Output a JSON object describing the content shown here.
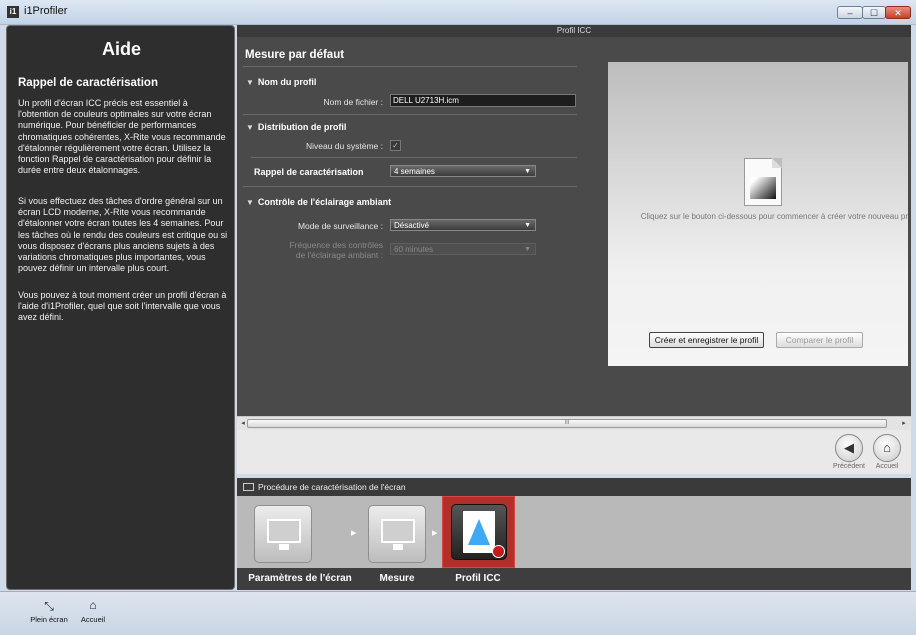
{
  "window": {
    "title": "i1Profiler",
    "app_icon": "i1",
    "controls": {
      "minimize": "‒",
      "maximize": "☐",
      "close": "✕"
    }
  },
  "help": {
    "title": "Aide",
    "subtitle": "Rappel de caractérisation",
    "paragraphs": [
      "Un profil d'écran ICC précis est essentiel à l'obtention de couleurs optimales sur votre écran numérique. Pour bénéficier de performances chromatiques cohérentes, X-Rite vous recommande d'étalonner régulièrement votre écran. Utilisez la fonction Rappel de caractérisation pour définir la durée entre deux étalonnages.",
      "Si vous effectuez des tâches d'ordre général sur un écran LCD moderne, X-Rite vous recommande d'étalonner votre écran toutes les 4 semaines. Pour les tâches où le rendu des couleurs est critique ou si vous disposez d'écrans plus anciens sujets à des variations chromatiques plus importantes, vous pouvez définir un intervalle plus court.",
      "Vous pouvez à tout moment créer un profil d'écran à l'aide d'i1Profiler, quel que soit l'intervalle que vous avez défini."
    ]
  },
  "main": {
    "header": "Profil ICC",
    "section_title": "Mesure par défaut",
    "profile_name": {
      "title": "Nom du profil",
      "filename_label": "Nom de fichier :",
      "filename_value": "DELL U2713H.icm"
    },
    "distribution": {
      "title": "Distribution de profil",
      "system_level_label": "Niveau du système :",
      "system_level_check": "✓"
    },
    "reminder": {
      "label": "Rappel de caractérisation",
      "value": "4 semaines"
    },
    "ambient": {
      "title": "Contrôle de l'éclairage ambiant",
      "mode_label": "Mode de surveillance :",
      "mode_value": "Désactivé",
      "frequency_label": "Fréquence des contrôles de l'éclairage ambiant :",
      "frequency_value": "60 minutes"
    },
    "preview": {
      "hint": "Cliquez sur le bouton ci-dessous pour commencer à créer votre nouveau pr",
      "create_button": "Créer et enregistrer le profil",
      "compare_button": "Comparer le profil"
    }
  },
  "scrollbar": {
    "left": "◂",
    "right": "▸",
    "grip": "III"
  },
  "nav": {
    "previous_label": "Précédent",
    "previous_glyph": "◀",
    "home_label": "Accueil",
    "home_glyph": "⌂"
  },
  "procedure": {
    "title": "Procédure de caractérisation de l'écran",
    "steps": [
      {
        "label": "Paramètres de l'écran"
      },
      {
        "label": "Mesure"
      },
      {
        "label": "Profil ICC"
      }
    ],
    "arrow": "▸"
  },
  "bottom_bar": {
    "fullscreen_label": "Plein écran",
    "fullscreen_glyph": "⤡",
    "home_label": "Accueil",
    "home_glyph": "⌂"
  },
  "colors": {
    "panel_dark": "#2e2e2e",
    "content_bg": "#4a4a4a",
    "active_step": "#b3302a",
    "window_frame": "#cfdbe9"
  }
}
